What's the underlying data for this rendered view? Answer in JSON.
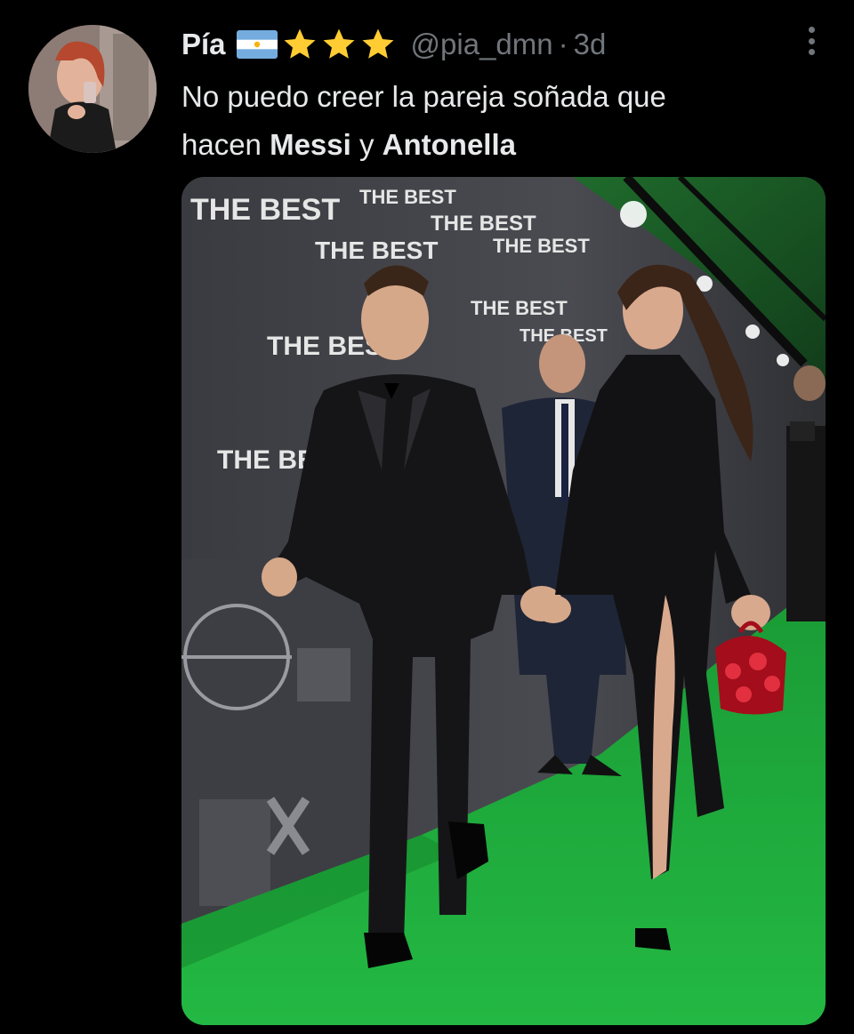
{
  "author": {
    "name": "Pía",
    "handle": "@pia_dmn",
    "separator": "·",
    "time": "3d",
    "flag": "argentina-flag",
    "badges": [
      "star-icon",
      "star-icon",
      "star-icon"
    ]
  },
  "tweet": {
    "line1": "No puedo creer la pareja soñada que",
    "line2_prefix": "hacen ",
    "bold1": "Messi",
    "connector": " y ",
    "bold2": "Antonella"
  },
  "media": {
    "wall_text": "THE BEST"
  },
  "colors": {
    "background": "#000000",
    "text": "#e7e9ea",
    "muted": "#71767b",
    "carpet": "#1fae3a",
    "star": "#ffcc33"
  }
}
